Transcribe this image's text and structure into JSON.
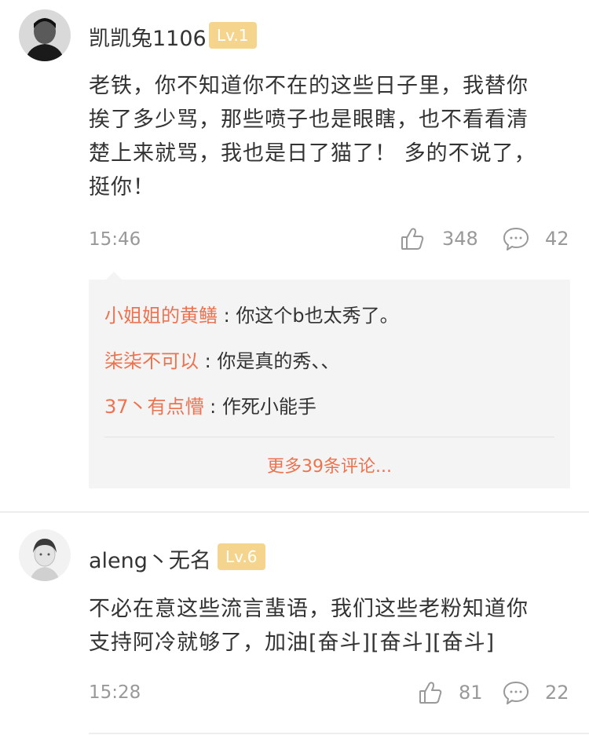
{
  "comments": [
    {
      "username": "凯凯兔1106",
      "level": "Lv.1",
      "text_lines": [
        "老铁，你不知道你不在的这些日子里，我替你",
        "挨了多少骂，那些喷子也是眼瞎，也不看看清",
        "楚上来就骂，我也是日了猫了！  多的不说了，",
        "挺你！"
      ],
      "time": "15:46",
      "likes": "348",
      "comment_count": "42",
      "replies": [
        {
          "name": "小姐姐的黄鳝",
          "sep": " : ",
          "text": "你这个b也太秀了。"
        },
        {
          "name": "柒柒不可以",
          "sep": " : ",
          "text": "你是真的秀、、"
        },
        {
          "name": "37丶有点懵",
          "sep": " : ",
          "text": "作死小能手"
        }
      ],
      "more_label": "更多39条评论..."
    },
    {
      "username": "aleng丶无名",
      "level": "Lv.6",
      "text_lines": [
        "不必在意这些流言蜚语，我们这些老粉知道你",
        "支持阿冷就够了，加油[奋斗][奋斗][奋斗]"
      ],
      "time": "15:28",
      "likes": "81",
      "comment_count": "22"
    }
  ],
  "icons": {
    "like": "thumbs-up-icon",
    "comment": "speech-bubble-icon"
  },
  "colors": {
    "accent": "#eb7350",
    "level_badge": "#f5d58e",
    "muted": "#999999",
    "reply_bg": "#f4f4f4"
  }
}
